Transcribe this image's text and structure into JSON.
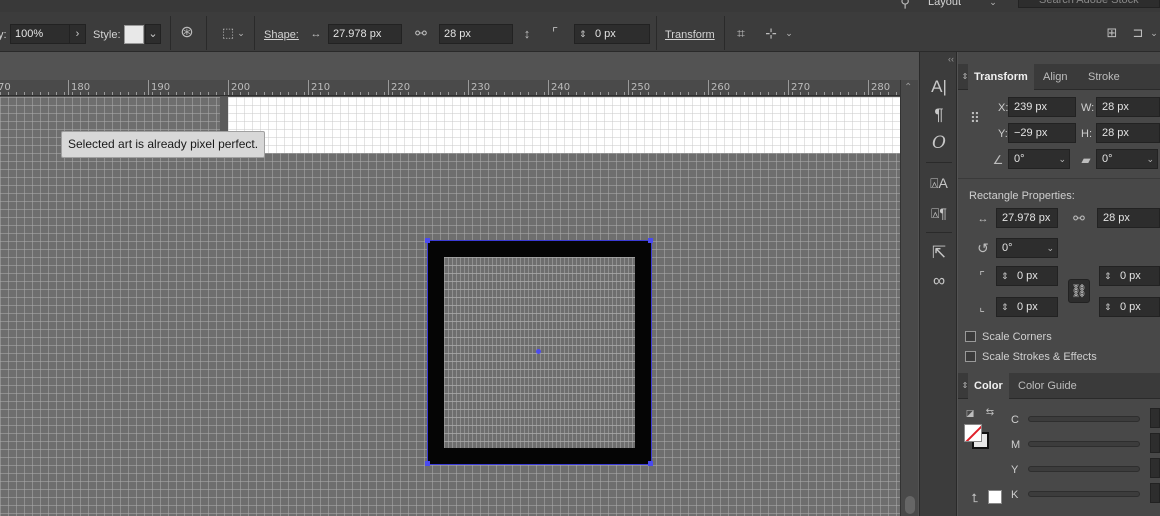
{
  "control_bar": {
    "opacity_suffix": "y:",
    "opacity_value": "100%",
    "style_label": "Style:",
    "shape_label": "Shape:",
    "width_value": "27.978 px",
    "height_value": "28 px",
    "corner_value": "0 px",
    "transform_label": "Transform",
    "search_placeholder": "Search Adobe Stock",
    "workspace_label": "Layout"
  },
  "ruler": {
    "ticks": [
      "70",
      "180",
      "190",
      "200",
      "210",
      "220",
      "230",
      "240",
      "250",
      "260",
      "270",
      "280"
    ]
  },
  "canvas": {
    "tooltip": "Selected art is already pixel perfect."
  },
  "panel": {
    "tabs": [
      "Transform",
      "Align",
      "Stroke"
    ],
    "x_label": "X:",
    "x_value": "239 px",
    "w_label": "W:",
    "w_value": "28 px",
    "y_label": "Y:",
    "y_value": "−29 px",
    "h_label": "H:",
    "h_value": "28 px",
    "rotate_value": "0°",
    "shear_value": "0°",
    "rect_props_heading": "Rectangle Properties:",
    "rect_width": "27.978 px",
    "rect_height": "28 px",
    "rect_rotation": "0°",
    "corner_tl": "0 px",
    "corner_tr": "0 px",
    "corner_bl": "0 px",
    "corner_br": "0 px",
    "scale_corners": "Scale Corners",
    "scale_strokes": "Scale Strokes & Effects",
    "color_tabs": [
      "Color",
      "Color Guide"
    ],
    "color_channels": [
      "C",
      "M",
      "Y",
      "K"
    ]
  },
  "colors": {
    "selection": "#4a4af0",
    "rect_stroke": "#050505",
    "canvas": "#6e6e6e",
    "artboard": "#ffffff"
  }
}
